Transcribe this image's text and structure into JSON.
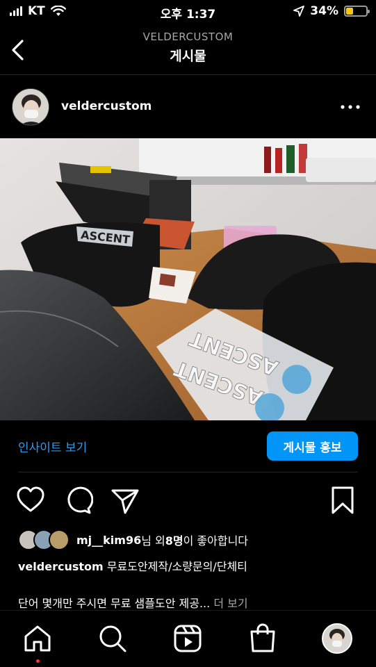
{
  "status_bar": {
    "carrier": "KT",
    "time": "오후 1:37",
    "battery": "34%",
    "battery_level": 0.34,
    "icons": [
      "signal-icon",
      "wifi-icon",
      "location-arrow-icon",
      "battery-icon"
    ]
  },
  "header": {
    "subtitle": "VELDERCUSTOM",
    "title": "게시물"
  },
  "post": {
    "username": "veldercustom",
    "image_text": [
      "ASCENT",
      "ASCENT"
    ],
    "image_shirt_print": "ASCENT"
  },
  "insights": {
    "link": "인사이트 보기",
    "promote": "게시물 홍보"
  },
  "likes": {
    "user": "mj__kim96",
    "mid": "님 외 ",
    "count": "8명",
    "tail": "이 좋아합니다"
  },
  "caption": {
    "username": "veldercustom",
    "text": "무료도안제작/소량문의/단체티",
    "line2": "단어 몇개만 주시면 무료 샘플도안 제공...",
    "more": "더 보기"
  },
  "colors": {
    "accent": "#0095f6",
    "link": "#2f9cf0",
    "background": "#000000",
    "battery": "#f5c518",
    "notification_dot": "#ff3040"
  }
}
